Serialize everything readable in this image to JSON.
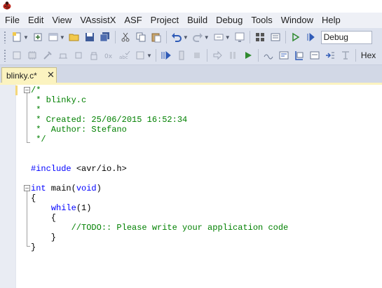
{
  "menu": {
    "items": [
      "File",
      "Edit",
      "View",
      "VAssistX",
      "ASF",
      "Project",
      "Build",
      "Debug",
      "Tools",
      "Window",
      "Help"
    ]
  },
  "toolbar": {
    "configuration": "Debug",
    "hex_label": "Hex"
  },
  "tab": {
    "title": "blinky.c*",
    "close_glyph": "✕"
  },
  "editor": {
    "lines": [
      {
        "tokens": [
          {
            "t": "/*",
            "c": "comment"
          }
        ]
      },
      {
        "tokens": [
          {
            "t": " * blinky.c",
            "c": "comment"
          }
        ]
      },
      {
        "tokens": [
          {
            "t": " *",
            "c": "comment"
          }
        ]
      },
      {
        "tokens": [
          {
            "t": " * Created: 25/06/2015 16:52:34",
            "c": "comment"
          }
        ]
      },
      {
        "tokens": [
          {
            "t": " *  Author: Stefano",
            "c": "comment"
          }
        ]
      },
      {
        "tokens": [
          {
            "t": " */",
            "c": "comment"
          }
        ]
      },
      {
        "tokens": []
      },
      {
        "tokens": []
      },
      {
        "tokens": [
          {
            "t": "#include ",
            "c": "keyword"
          },
          {
            "t": "<avr/io.h>",
            "c": "text"
          }
        ]
      },
      {
        "tokens": []
      },
      {
        "tokens": [
          {
            "t": "int",
            "c": "keyword"
          },
          {
            "t": " main(",
            "c": "text"
          },
          {
            "t": "void",
            "c": "keyword"
          },
          {
            "t": ")",
            "c": "text"
          }
        ]
      },
      {
        "tokens": [
          {
            "t": "{",
            "c": "text"
          }
        ]
      },
      {
        "tokens": [
          {
            "t": "    ",
            "c": "text"
          },
          {
            "t": "while",
            "c": "keyword"
          },
          {
            "t": "(1)",
            "c": "text"
          }
        ]
      },
      {
        "tokens": [
          {
            "t": "    {",
            "c": "text"
          }
        ]
      },
      {
        "tokens": [
          {
            "t": "        ",
            "c": "text"
          },
          {
            "t": "//TODO:: Please write your application code",
            "c": "comment"
          }
        ]
      },
      {
        "tokens": [
          {
            "t": "    }",
            "c": "text"
          }
        ]
      },
      {
        "tokens": [
          {
            "t": "}",
            "c": "text"
          }
        ]
      }
    ]
  }
}
